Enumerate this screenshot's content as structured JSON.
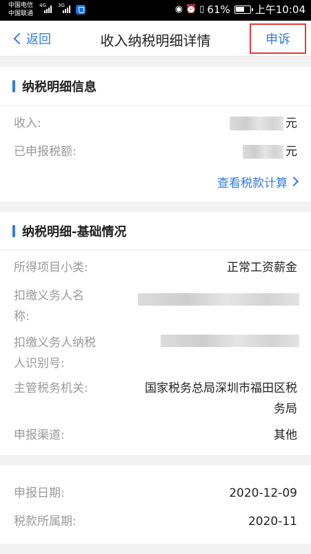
{
  "status_bar": {
    "carrier1": "中国电信",
    "carrier2": "中国联通",
    "net1": "4G",
    "net2": "3G",
    "battery": "61%",
    "time": "上午10:04",
    "icons": [
      "shield-app-icon",
      "eye-icon",
      "alarm-icon",
      "vibrate-icon",
      "battery-icon"
    ]
  },
  "nav": {
    "back_label": "返回",
    "title": "收入纳税明细详情",
    "appeal_label": "申诉",
    "highlight_color": "#e53935",
    "accent_color": "#2f7be5"
  },
  "tax_info": {
    "title": "纳税明细信息",
    "income_label": "收入:",
    "income_unit": "元",
    "declared_tax_label": "已申报税额:",
    "declared_tax_unit": "元",
    "view_calc_link": "查看税款计算"
  },
  "basic": {
    "title": "纳税明细-基础情况",
    "item_category_label": "所得项目小类:",
    "item_category_value": "正常工资薪金",
    "withholder_name_label_1": "扣缴义务人名",
    "withholder_name_label_2": "称:",
    "withholder_id_label_1": "扣缴义务人纳税",
    "withholder_id_label_2": "人识别号:",
    "tax_authority_label": "主管税务机关:",
    "tax_authority_value_1": "国家税务总局深圳市福田区税",
    "tax_authority_value_2": "务局",
    "channel_label": "申报渠道:",
    "channel_value": "其他"
  },
  "dates": {
    "declare_date_label": "申报日期:",
    "declare_date_value": "2020-12-09",
    "tax_period_label": "税款所属期:",
    "tax_period_value": "2020-11"
  }
}
